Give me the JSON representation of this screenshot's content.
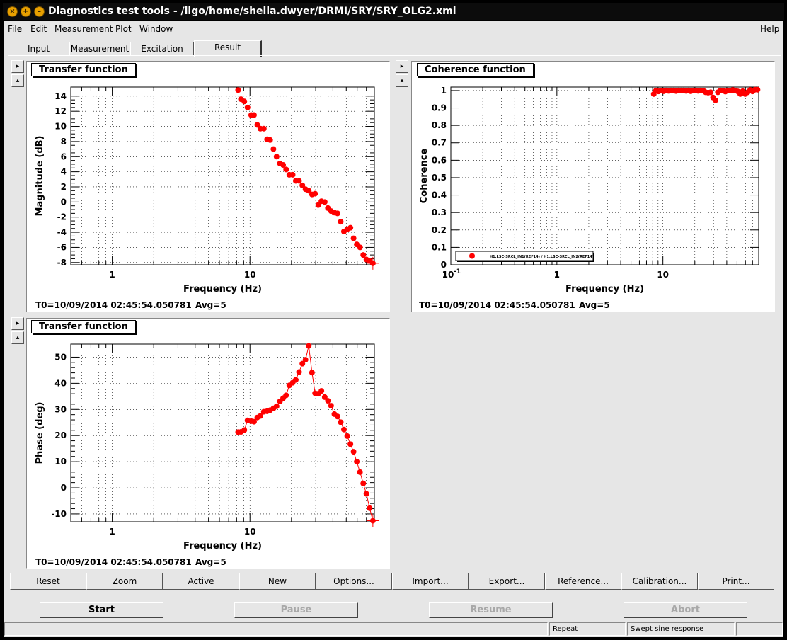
{
  "window": {
    "title": "Diagnostics test tools - /ligo/home/sheila.dwyer/DRMI/SRY/SRY_OLG2.xml",
    "buttons": [
      "close",
      "maximize",
      "minimize"
    ]
  },
  "menubar": {
    "file": {
      "u": "F",
      "rest": "ile"
    },
    "edit": {
      "u": "E",
      "rest": "dit"
    },
    "measurement": {
      "u": "M",
      "rest": "easurement"
    },
    "plot": {
      "u": "P",
      "rest": "lot"
    },
    "window": {
      "u": "W",
      "rest": "indow"
    },
    "help": {
      "u": "H",
      "rest": "elp"
    }
  },
  "tabs": [
    "Input",
    "Measurement",
    "Excitation",
    "Result"
  ],
  "active_tab": "Result",
  "side_buttons": {
    "expand": "▸",
    "collapse": "▴"
  },
  "panels": {
    "magnitude": {
      "title": "Transfer function",
      "t0": "T0=10/09/2014 02:45:54.050781",
      "avg": "Avg=5"
    },
    "coherence": {
      "title": "Coherence function",
      "t0": "T0=10/09/2014 02:45:54.050781",
      "avg": "Avg=5",
      "legend": "H1:LSC-SRCL_IN1(REF14) / H1:LSC-SRCL_IN2(REF14)"
    },
    "phase": {
      "title": "Transfer function",
      "t0": "T0=10/09/2014 02:45:54.050781",
      "avg": "Avg=5"
    }
  },
  "chart_data": [
    {
      "type": "scatter",
      "title": "Transfer function",
      "xlabel": "Frequency (Hz)",
      "ylabel": "Magnitude (dB)",
      "xscale": "log",
      "xlim": [
        0.5,
        80
      ],
      "ylim": [
        -8.3,
        15.2
      ],
      "xticks": [
        1,
        10
      ],
      "yticks": [
        -8,
        -6,
        -4,
        -2,
        0,
        2,
        4,
        6,
        8,
        10,
        12,
        14
      ],
      "grid": true,
      "color": "#ff0000",
      "x": [
        8.2,
        8.6,
        9.1,
        9.6,
        10.2,
        10.7,
        11.3,
        11.9,
        12.6,
        13.3,
        14,
        14.8,
        15.6,
        16.5,
        17.4,
        18.3,
        19.3,
        20.4,
        21.5,
        22.7,
        24,
        25.3,
        26.7,
        28.2,
        29.7,
        31.3,
        33,
        34.9,
        36.8,
        38.8,
        41,
        43.2,
        45.6,
        48.1,
        50.8,
        53.6,
        56.5,
        59.6,
        62.9,
        66.4,
        70,
        73.9,
        78
      ],
      "y": [
        14.8,
        13.6,
        13.3,
        12.5,
        11.5,
        11.5,
        10.2,
        9.7,
        9.7,
        8.3,
        8.2,
        7.0,
        6.0,
        5.1,
        4.9,
        4.3,
        3.6,
        3.6,
        2.8,
        2.8,
        2.2,
        1.7,
        1.5,
        1.0,
        1.1,
        -0.4,
        0.1,
        0.0,
        -0.8,
        -1.2,
        -1.4,
        -1.5,
        -2.6,
        -3.9,
        -3.6,
        -3.4,
        -4.8,
        -5.6,
        -6.0,
        -7.0,
        -7.6,
        -7.8,
        -8.1
      ]
    },
    {
      "type": "scatter",
      "title": "Coherence function",
      "xlabel": "Frequency (Hz)",
      "ylabel": "Coherence",
      "xscale": "log",
      "xlim": [
        0.1,
        80
      ],
      "ylim": [
        0,
        1.02
      ],
      "xticks": [
        0.1,
        1,
        10
      ],
      "xtick_labels": [
        "10^-1",
        "1",
        "10"
      ],
      "yticks": [
        0,
        0.1,
        0.2,
        0.3,
        0.4,
        0.5,
        0.6,
        0.7,
        0.8,
        0.9,
        1
      ],
      "grid": true,
      "legend": "bottom-left",
      "series": [
        {
          "name": "H1:LSC-SRCL_IN1(REF14) / H1:LSC-SRCL_IN2(REF14)",
          "color": "#ff0000"
        }
      ],
      "x": [
        8.2,
        8.6,
        9.1,
        9.6,
        10.2,
        10.7,
        11.3,
        11.9,
        12.6,
        13.3,
        14,
        14.8,
        15.6,
        16.5,
        17.4,
        18.3,
        19.3,
        20.4,
        21.5,
        22.7,
        24,
        25.3,
        26.7,
        28.2,
        29.7,
        31.3,
        33,
        34.9,
        36.8,
        38.8,
        41,
        43.2,
        45.6,
        48.1,
        50.8,
        53.6,
        56.5,
        59.6,
        62.9,
        66.4,
        70,
        73.9,
        78
      ],
      "y": [
        0.98,
        1.0,
        0.995,
        1.0,
        0.996,
        1.0,
        0.998,
        1.0,
        1.0,
        0.997,
        1.0,
        1.0,
        1.0,
        0.998,
        1.0,
        0.996,
        1.0,
        1.0,
        0.998,
        1.0,
        1.0,
        0.99,
        0.988,
        0.99,
        0.96,
        0.944,
        0.99,
        1.0,
        1.0,
        0.994,
        1.0,
        1.0,
        1.003,
        1.0,
        0.995,
        0.98,
        0.996,
        0.98,
        0.99,
        1.003,
        0.995,
        1.005,
        1.005
      ]
    },
    {
      "type": "line",
      "title": "Transfer function",
      "xlabel": "Frequency (Hz)",
      "ylabel": "Phase (deg)",
      "xscale": "log",
      "xlim": [
        0.5,
        80
      ],
      "ylim": [
        -13,
        55
      ],
      "xticks": [
        1,
        10
      ],
      "yticks": [
        -10,
        0,
        10,
        20,
        30,
        40,
        50
      ],
      "grid": true,
      "color": "#ff0000",
      "x": [
        8.2,
        8.6,
        9.1,
        9.6,
        10.2,
        10.7,
        11.3,
        11.9,
        12.6,
        13.3,
        14,
        14.8,
        15.6,
        16.5,
        17.4,
        18.3,
        19.3,
        20.4,
        21.5,
        22.7,
        24,
        25.3,
        26.7,
        28.2,
        29.7,
        31.3,
        33,
        34.9,
        36.8,
        38.8,
        41,
        43.2,
        45.6,
        48.1,
        50.8,
        53.6,
        56.5,
        59.6,
        62.9,
        66.4,
        70,
        73.9,
        78
      ],
      "y": [
        21.3,
        21.4,
        22.1,
        25.8,
        25.5,
        25.3,
        26.9,
        27.5,
        29.1,
        29.3,
        29.7,
        30.4,
        31.2,
        33.1,
        34.3,
        35.4,
        39.2,
        40.2,
        41.3,
        44.3,
        47.5,
        49.0,
        54.3,
        44.1,
        36.2,
        36.0,
        37.1,
        34.7,
        33.3,
        31.4,
        28.2,
        27.3,
        25.1,
        22.3,
        19.8,
        16.7,
        13.8,
        10.0,
        6.0,
        1.7,
        -2.3,
        -7.8,
        -12.6
      ]
    }
  ],
  "toolbar": [
    "Reset",
    "Zoom",
    "Active",
    "New",
    "Options...",
    "Import...",
    "Export...",
    "Reference...",
    "Calibration...",
    "Print..."
  ],
  "controls": {
    "start": "Start",
    "pause": "Pause",
    "resume": "Resume",
    "abort": "Abort"
  },
  "status": {
    "mode": "Repeat",
    "type": "Swept sine response"
  }
}
